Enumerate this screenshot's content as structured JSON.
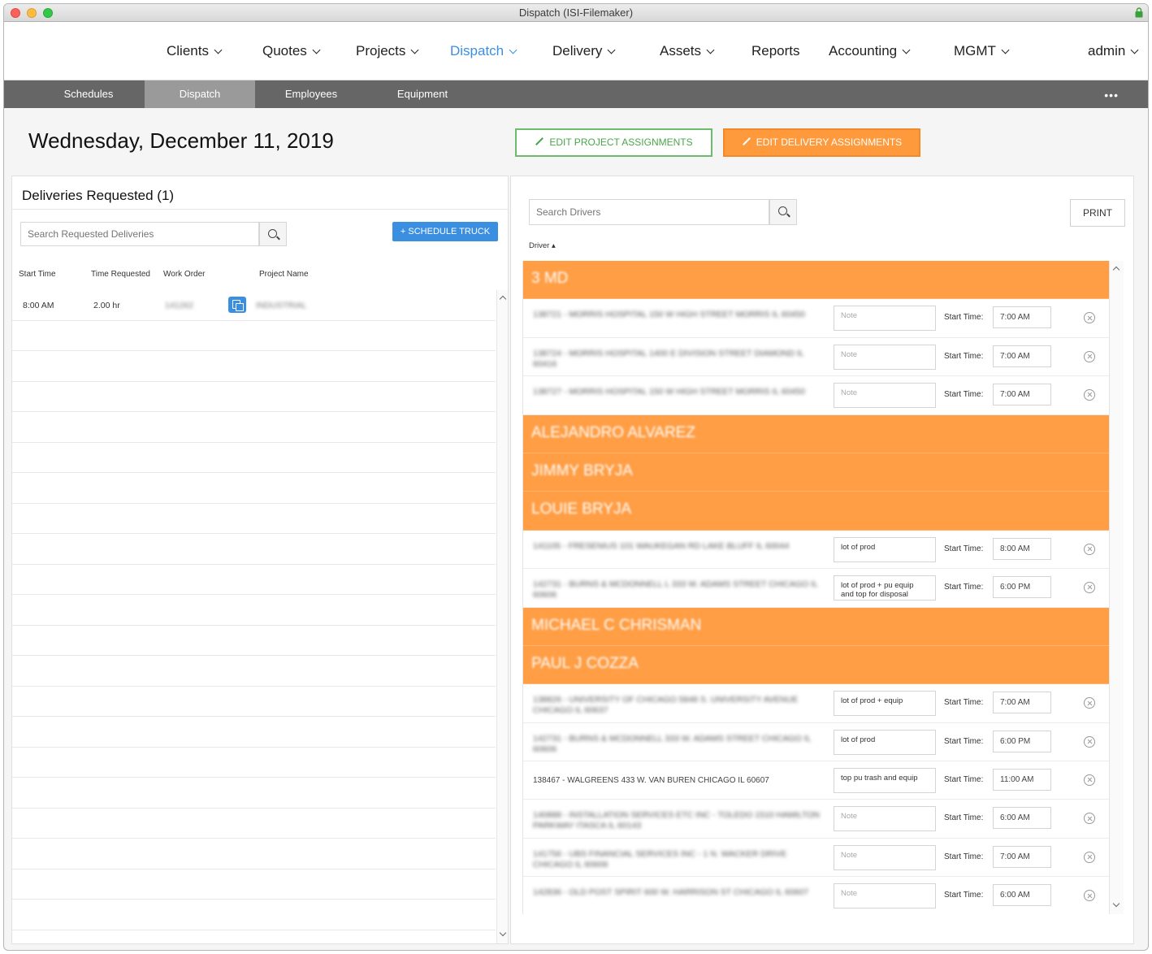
{
  "window": {
    "title": "Dispatch (ISI-Filemaker)"
  },
  "nav": {
    "items": [
      {
        "label": "Clients",
        "dropdown": true,
        "active": false
      },
      {
        "label": "Quotes",
        "dropdown": true,
        "active": false
      },
      {
        "label": "Projects",
        "dropdown": true,
        "active": false
      },
      {
        "label": "Dispatch",
        "dropdown": true,
        "active": true
      },
      {
        "label": "Delivery",
        "dropdown": true,
        "active": false
      },
      {
        "label": "Assets",
        "dropdown": true,
        "active": false
      },
      {
        "label": "Reports",
        "dropdown": false,
        "active": false
      },
      {
        "label": "Accounting",
        "dropdown": true,
        "active": false
      },
      {
        "label": "MGMT",
        "dropdown": true,
        "active": false
      },
      {
        "label": "admin",
        "dropdown": true,
        "active": false
      }
    ]
  },
  "subnav": {
    "tabs": [
      {
        "label": "Schedules",
        "active": false
      },
      {
        "label": "Dispatch",
        "active": true
      },
      {
        "label": "Employees",
        "active": false
      },
      {
        "label": "Equipment",
        "active": false
      }
    ],
    "more": "•••"
  },
  "page": {
    "date": "Wednesday, December 11, 2019",
    "edit_project_label": "EDIT PROJECT ASSIGNMENTS",
    "edit_delivery_label": "EDIT DELIVERY ASSIGNMENTS"
  },
  "deliveries": {
    "title": "Deliveries Requested (1)",
    "search_placeholder": "Search Requested Deliveries",
    "schedule_label": "+ SCHEDULE TRUCK",
    "columns": [
      "Start Time",
      "Time Requested",
      "Work Order",
      "Project Name"
    ],
    "rows": [
      {
        "start": "8:00 AM",
        "requested": "2.00 hr",
        "work_order": "141262",
        "project": "INDUSTRIAL"
      }
    ]
  },
  "drivers": {
    "search_placeholder": "Search Drivers",
    "print_label": "PRINT",
    "sort_label": "Driver ▴",
    "start_time_label": "Start Time:",
    "groups": [
      {
        "name": "3 MD",
        "rows": [
          {
            "desc": "138721 - MORRIS HOSPITAL 150 W HIGH STREET MORRIS IL 60450",
            "note": "",
            "time": "7:00 AM"
          },
          {
            "desc": "138724 - MORRIS HOSPITAL 1400 E DIVISION STREET DIAMOND IL 60416",
            "note": "",
            "time": "7:00 AM"
          },
          {
            "desc": "138727 - MORRIS HOSPITAL 150 W HIGH STREET MORRIS IL 60450",
            "note": "",
            "time": "7:00 AM"
          }
        ]
      },
      {
        "name": "ALEJANDRO ALVAREZ",
        "rows": []
      },
      {
        "name": "JIMMY BRYJA",
        "rows": []
      },
      {
        "name": "LOUIE BRYJA",
        "rows": [
          {
            "desc": "141105 - FRESENIUS 101 WAUKEGAN RD LAKE BLUFF IL 60044",
            "note": "lot of prod",
            "time": "8:00 AM"
          },
          {
            "desc": "142731 - BURNS & MCDONNELL L 333 W. ADAMS STREET CHICAGO IL 60606",
            "note": "lot of prod + pu equip and top for disposal",
            "time": "6:00 PM"
          }
        ]
      },
      {
        "name": "MICHAEL C CHRISMAN",
        "rows": []
      },
      {
        "name": "PAUL J COZZA",
        "rows": [
          {
            "desc": "138826 - UNIVERSITY OF CHICAGO 5848 S. UNIVERSITY AVENUE CHICAGO IL 60637",
            "note": "lot of prod + equip",
            "time": "7:00 AM"
          },
          {
            "desc": "142731 - BURNS & MCDONNELL 333 W. ADAMS STREET CHICAGO IL 60606",
            "note": "lot of prod",
            "time": "6:00 PM"
          },
          {
            "desc": "138467 - WALGREENS 433 W. VAN BUREN CHICAGO IL 60607",
            "note": "top pu trash and equip",
            "time": "11:00 AM",
            "clear": true
          },
          {
            "desc": "140888 - INSTALLATION SERVICES ETC INC - TOLEDO 1510 HAMILTON PARKWAY ITASCA IL 60143",
            "note": "",
            "time": "6:00 AM"
          },
          {
            "desc": "141756 - UBS FINANCIAL SERVICES INC - 1 N. WACKER DRIVE CHICAGO IL 60606",
            "note": "",
            "time": "7:00 AM"
          },
          {
            "desc": "142836 - OLD POST SPIRIT 600 W. HARRISON ST CHICAGO IL 60607",
            "note": "",
            "time": "6:00 AM"
          }
        ]
      }
    ],
    "note_placeholder": "Note"
  },
  "colors": {
    "accent_orange": "#ff9e45",
    "accent_blue": "#3b8fe0",
    "accent_green": "#4aa64a",
    "subnav_bg": "#666666"
  }
}
